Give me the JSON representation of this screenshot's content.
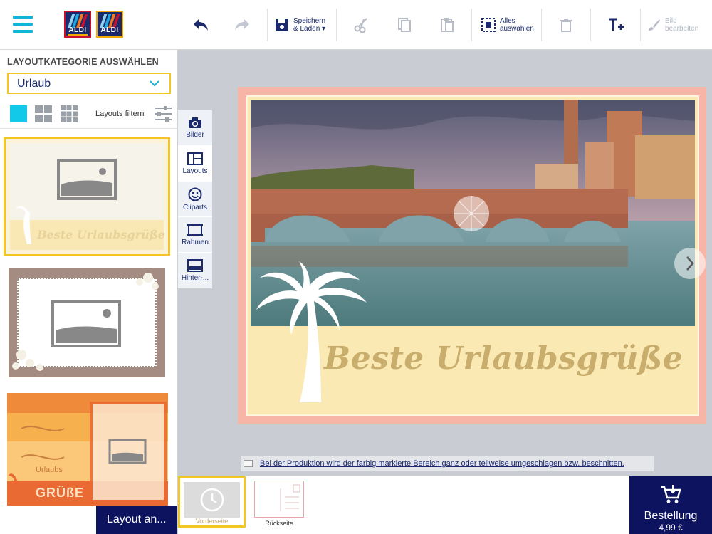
{
  "toolbar": {
    "save_label_1": "Speichern",
    "save_label_2": "& Laden ▾",
    "select_all_1": "Alles",
    "select_all_2": "auswählen",
    "edit_image_1": "Bild",
    "edit_image_2": "bearbeiten"
  },
  "logos": {
    "logo1": "ALDI",
    "logo2": "ALDI"
  },
  "left_panel": {
    "title": "LAYOUTKATEGORIE AUSWÄHLEN",
    "category_value": "Urlaub",
    "filter_label": "Layouts filtern",
    "thumb1_text": "Beste Urlaubsgrüße",
    "thumb3_text1": "Urlaubs",
    "thumb3_text2": "GRÜßE",
    "layout_button": "Layout an..."
  },
  "tabs": [
    {
      "label": "Bilder",
      "icon": "camera-icon"
    },
    {
      "label": "Layouts",
      "icon": "layout-icon"
    },
    {
      "label": "Cliparts",
      "icon": "smiley-icon"
    },
    {
      "label": "Rahmen",
      "icon": "frame-icon"
    },
    {
      "label": "Hinter-...",
      "icon": "background-icon"
    }
  ],
  "card": {
    "headline": "Beste Urlaubsgrüße"
  },
  "notice": {
    "text": "Bei der Produktion wird der farbig markierte Bereich ganz oder teilweise umgeschlagen bzw. beschnitten."
  },
  "pages": {
    "front": "Vorderseite",
    "back": "Rückseite"
  },
  "order": {
    "label": "Bestellung",
    "price": "4,99 €"
  },
  "colors": {
    "accent": "#12b4d8",
    "navy": "#0e1360",
    "highlight": "#f3c623",
    "card_bg": "#fbe9b4",
    "card_border": "#f6b5a7"
  }
}
